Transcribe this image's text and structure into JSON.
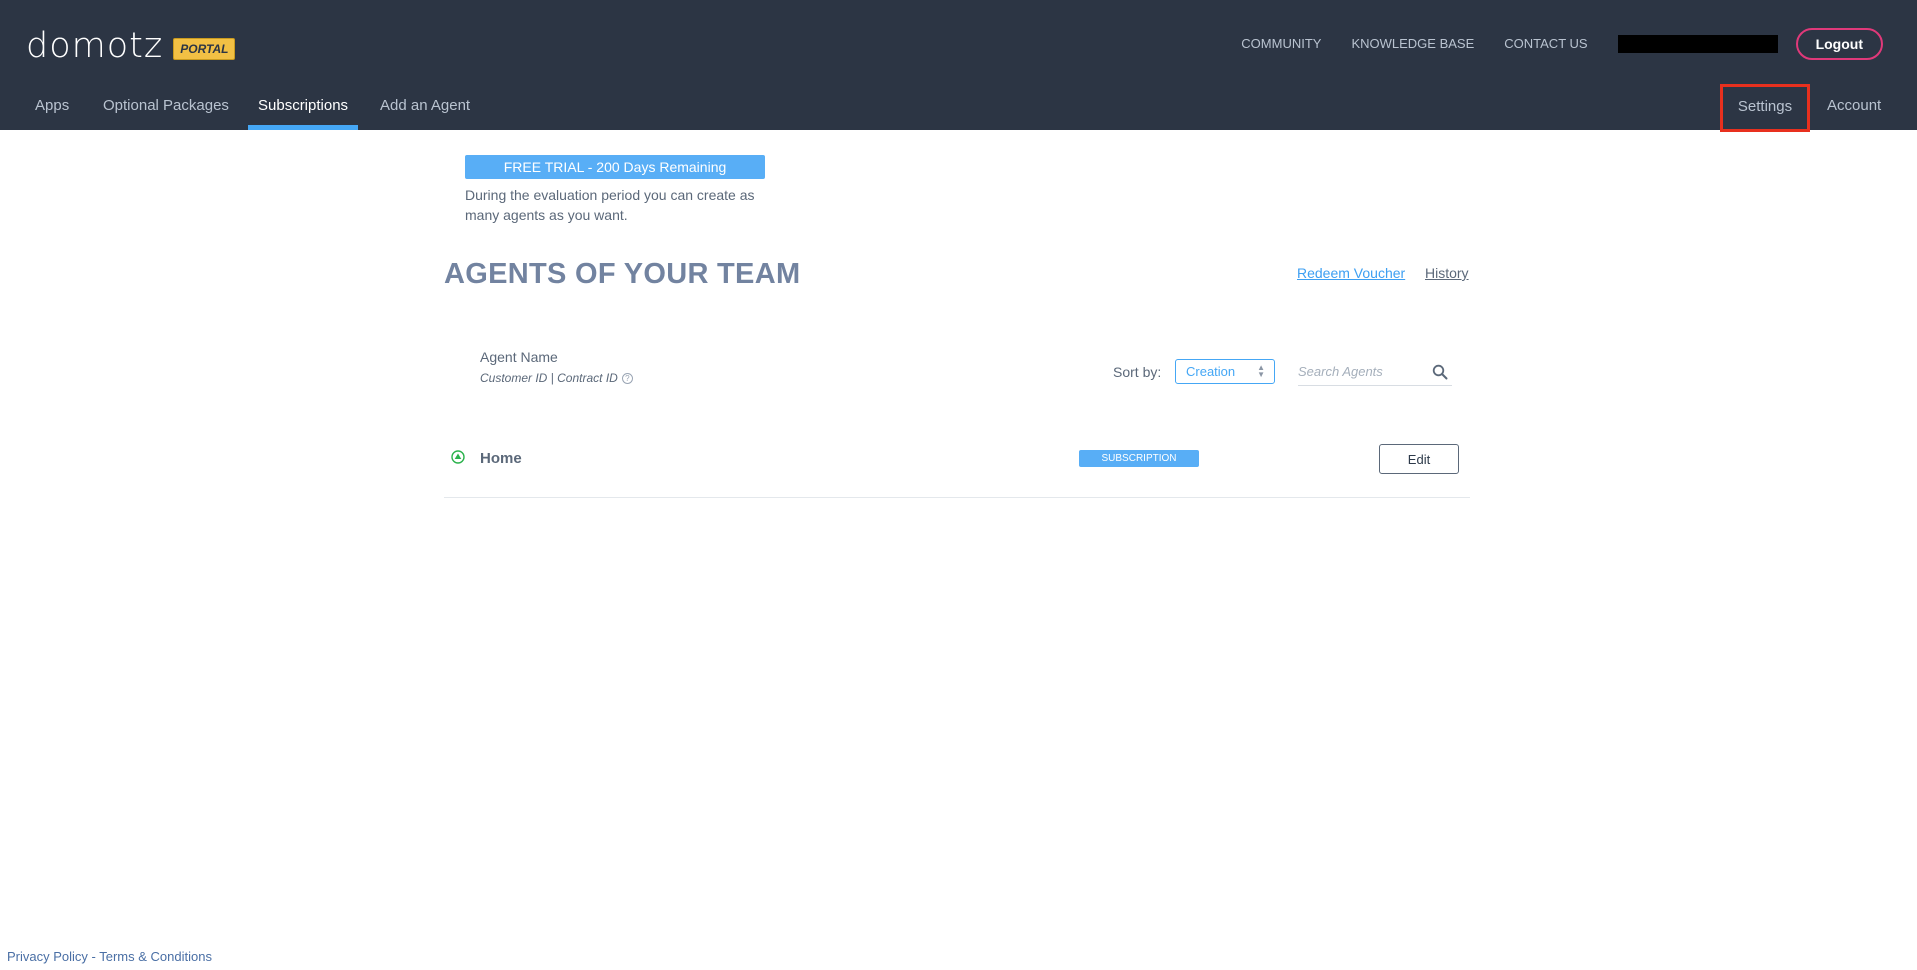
{
  "header": {
    "logo_text": "domotz",
    "logo_badge": "PORTAL",
    "top_links": [
      "COMMUNITY",
      "KNOWLEDGE BASE",
      "CONTACT US"
    ],
    "logout_label": "Logout"
  },
  "nav": {
    "left_items": [
      "Apps",
      "Optional Packages",
      "Subscriptions",
      "Add an Agent"
    ],
    "active_item": "Subscriptions",
    "settings_label": "Settings",
    "account_label": "Account"
  },
  "trial": {
    "badge": "FREE TRIAL - 200 Days Remaining",
    "description": "During the evaluation period you can create as many agents as you want."
  },
  "main": {
    "title": "AGENTS OF YOUR TEAM",
    "redeem_voucher": "Redeem Voucher",
    "history": "History",
    "column_agent_name": "Agent Name",
    "column_ids": "Customer ID | Contract ID",
    "sort_label": "Sort by:",
    "sort_value": "Creation",
    "search_placeholder": "Search Agents"
  },
  "agents": [
    {
      "name": "Home",
      "badge": "SUBSCRIPTION",
      "edit_label": "Edit",
      "status": "online"
    }
  ],
  "footer": {
    "privacy": "Privacy Policy",
    "separator": " - ",
    "terms": "Terms & Conditions"
  },
  "colors": {
    "header_bg": "#2c3544",
    "accent_blue": "#45a7f5",
    "logout_border": "#e0397a",
    "highlight_red": "#e8301e",
    "status_green": "#2bb24c"
  }
}
